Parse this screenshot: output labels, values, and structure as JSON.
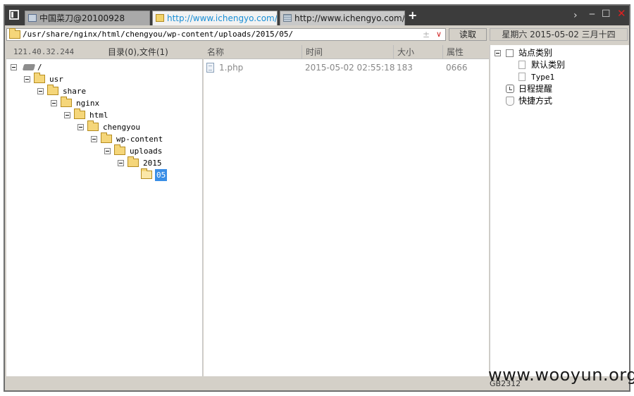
{
  "tabs": [
    {
      "label": "中国菜刀@20100928",
      "active": false
    },
    {
      "label": "http://www.ichengyo.com/w...",
      "active": true
    },
    {
      "label": "http://www.ichengyo.com/w...",
      "active": false
    }
  ],
  "new_tab_label": "+",
  "window_controls": {
    "next": "›",
    "minimize": "‒",
    "maximize": "☐",
    "close": "✕"
  },
  "address": {
    "path": "/usr/share/nginx/html/chengyou/wp-content/uploads/2015/05/",
    "plus": "±",
    "dropdown": "∨"
  },
  "read_button": "读取",
  "datetime": "星期六 2015-05-02 三月十四",
  "left_panel": {
    "ip": "121.40.32.244",
    "counts": "目录(0),文件(1)",
    "tree": [
      {
        "label": "/",
        "type": "drive"
      },
      {
        "label": "usr",
        "type": "folder"
      },
      {
        "label": "share",
        "type": "folder"
      },
      {
        "label": "nginx",
        "type": "folder"
      },
      {
        "label": "html",
        "type": "folder"
      },
      {
        "label": "chengyou",
        "type": "folder"
      },
      {
        "label": "wp-content",
        "type": "folder"
      },
      {
        "label": "uploads",
        "type": "folder"
      },
      {
        "label": "2015",
        "type": "folder"
      },
      {
        "label": "05",
        "type": "folder-open",
        "selected": true
      }
    ]
  },
  "file_list": {
    "columns": [
      "名称",
      "时间",
      "大小",
      "属性"
    ],
    "rows": [
      {
        "name": "1.php",
        "time": "2015-05-02 02:55:18",
        "size": "183",
        "attr": "0666"
      }
    ]
  },
  "side_tree": {
    "site_category": "站点类别",
    "default_category": "默认类别",
    "type1": "Type1",
    "schedule": "日程提醒",
    "shortcuts": "快捷方式"
  },
  "status": {
    "encoding": "GB2312"
  },
  "watermark": "www.wooyun.org"
}
